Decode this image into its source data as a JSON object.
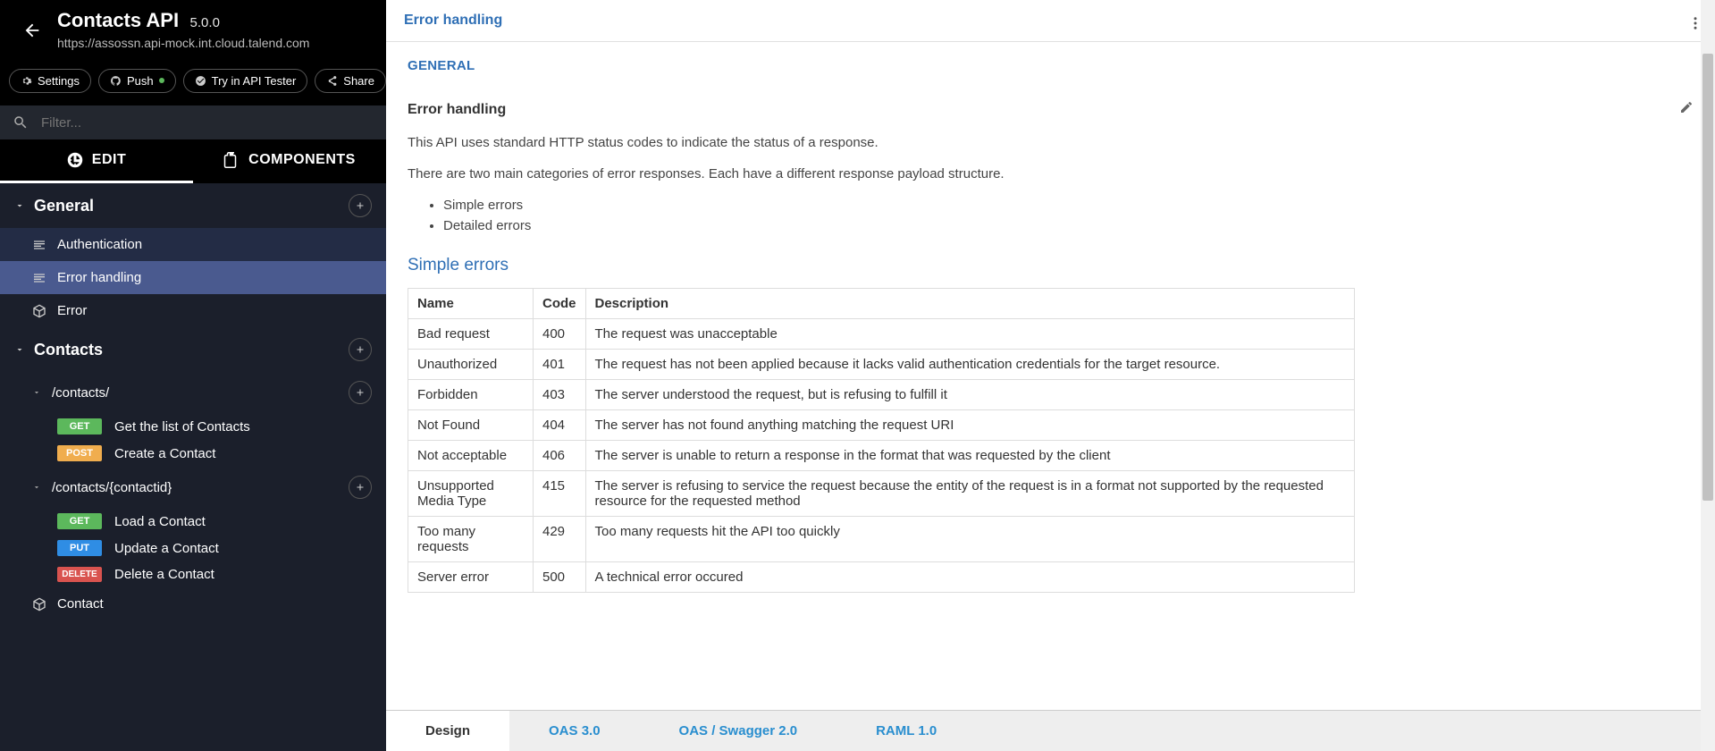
{
  "header": {
    "title": "Contacts API",
    "version": "5.0.0",
    "url": "https://assossn.api-mock.int.cloud.talend.com"
  },
  "toolbar": {
    "settings": "Settings",
    "push": "Push",
    "try": "Try in API Tester",
    "share": "Share"
  },
  "search": {
    "placeholder": "Filter..."
  },
  "tabs": {
    "edit": "EDIT",
    "components": "COMPONENTS"
  },
  "tree": {
    "general": {
      "label": "General",
      "items": [
        {
          "label": "Authentication"
        },
        {
          "label": "Error handling"
        },
        {
          "label": "Error"
        }
      ]
    },
    "contacts": {
      "label": "Contacts",
      "paths": [
        {
          "path": "/contacts/",
          "ops": [
            {
              "method": "GET",
              "label": "Get the list of Contacts"
            },
            {
              "method": "POST",
              "label": "Create a Contact"
            }
          ]
        },
        {
          "path": "/contacts/{contactid}",
          "ops": [
            {
              "method": "GET",
              "label": "Load a Contact"
            },
            {
              "method": "PUT",
              "label": "Update a Contact"
            },
            {
              "method": "DELETE",
              "label": "Delete a Contact"
            }
          ]
        }
      ],
      "types": [
        {
          "label": "Contact"
        }
      ]
    }
  },
  "main": {
    "breadcrumb": "Error handling",
    "section_label": "GENERAL",
    "title": "Error handling",
    "p1": "This API uses standard HTTP status codes to indicate the status of a response.",
    "p2": "There are two main categories of error responses. Each have a different response payload structure.",
    "bullets": [
      "Simple errors",
      "Detailed errors"
    ],
    "simple_head": "Simple errors",
    "table": {
      "headers": [
        "Name",
        "Code",
        "Description"
      ],
      "rows": [
        [
          "Bad request",
          "400",
          "The request was unacceptable"
        ],
        [
          "Unauthorized",
          "401",
          "The request has not been applied because it lacks valid authentication credentials for the target resource."
        ],
        [
          "Forbidden",
          "403",
          "The server understood the request, but is refusing to fulfill it"
        ],
        [
          "Not Found",
          "404",
          "The server has not found anything matching the request URI"
        ],
        [
          "Not acceptable",
          "406",
          "The server is unable to return a response in the format that was requested by the client"
        ],
        [
          "Unsupported Media Type",
          "415",
          "The server is refusing to service the request because the entity of the request is in a format not supported by the requested resource for the requested method"
        ],
        [
          "Too many requests",
          "429",
          "Too many requests hit the API too quickly"
        ],
        [
          "Server error",
          "500",
          "A technical error occured"
        ]
      ]
    }
  },
  "bottom_tabs": [
    "Design",
    "OAS 3.0",
    "OAS / Swagger 2.0",
    "RAML 1.0"
  ]
}
